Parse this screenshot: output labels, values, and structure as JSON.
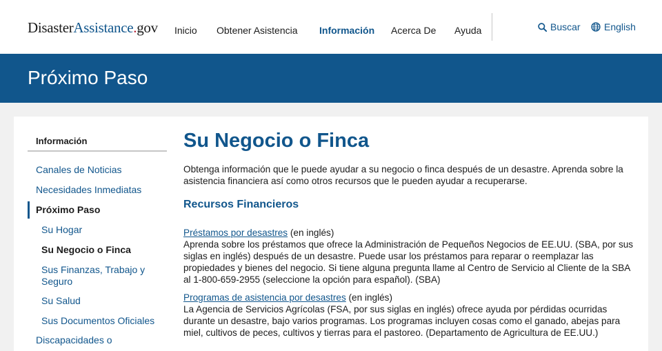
{
  "header": {
    "logo": {
      "part1": "Disaster",
      "part2": "Assistance",
      "part3": ".",
      "part4": "gov"
    },
    "nav": [
      "Inicio",
      "Obtener Asistencia",
      "Información",
      "Acerca De",
      "Ayuda"
    ],
    "active_nav": "Información",
    "search_label": "Buscar",
    "language_label": "English"
  },
  "banner": {
    "title": "Próximo Paso"
  },
  "sidebar": {
    "heading": "Información",
    "items": [
      "Canales de Noticias",
      "Necesidades Inmediatas",
      "Próximo Paso",
      "Su Hogar",
      "Su Negocio o Finca",
      "Sus Finanzas, Trabajo y Seguro",
      "Su Salud",
      "Sus Documentos Oficiales",
      "Discapacidades o"
    ]
  },
  "main": {
    "title": "Su Negocio o Finca",
    "intro": "Obtenga información que le puede ayudar a su negocio o finca después de un desastre. Aprenda sobre la asistencia financiera así como otros recursos que le pueden ayudar a recuperarse.",
    "section_title": "Recursos Financieros",
    "resources": [
      {
        "link": "Préstamos por desastres",
        "note": " (en inglés)",
        "text": "Aprenda sobre los préstamos que ofrece la Administración de Pequeños Negocios de EE.UU. (SBA, por sus siglas en inglés) después de un desastre. Puede usar los préstamos para reparar o reemplazar las propiedades y bienes del negocio. Si tiene alguna pregunta llame al Centro de Servicio al Cliente de la SBA al 1-800-659-2955 (seleccione la opción para español). (SBA)"
      },
      {
        "link": "Programas de asistencia por desastres",
        "note": " (en inglés)",
        "text": "La Agencia de Servicios Agrícolas (FSA, por sus siglas en inglés) ofrece ayuda por pérdidas ocurridas durante un desastre, bajo varios programas. Los programas incluyen cosas como el ganado, abejas para miel, cultivos de peces, cultivos y tierras para el pastoreo. (Departamento de Agricultura de EE.UU.)"
      }
    ]
  },
  "colors": {
    "brand_blue": "#11568c",
    "logo_red": "#b5182e",
    "page_bg": "#f1f1f1"
  },
  "icons": {
    "search": "search-icon",
    "language": "globe-icon"
  }
}
